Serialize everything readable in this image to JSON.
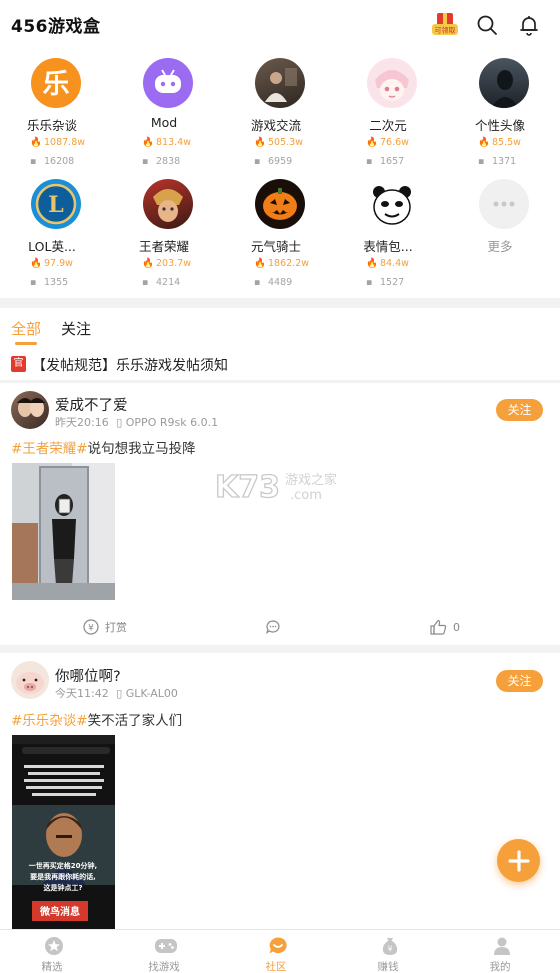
{
  "header": {
    "title": "456游戏盒",
    "gift_badge": "可领取"
  },
  "categories": [
    {
      "name": "乐乐杂谈",
      "heat": "1087.8w",
      "posts": "16208",
      "icon": "le-logo-icon"
    },
    {
      "name": "Mod",
      "heat": "813.4w",
      "posts": "2838",
      "icon": "gamepad-icon"
    },
    {
      "name": "游戏交流",
      "heat": "505.3w",
      "posts": "6959",
      "icon": "photo-icon"
    },
    {
      "name": "二次元",
      "heat": "76.6w",
      "posts": "1657",
      "icon": "anime-icon"
    },
    {
      "name": "个性头像",
      "heat": "85.5w",
      "posts": "1371",
      "icon": "portrait-icon"
    },
    {
      "name": "LOL英...",
      "heat": "97.9w",
      "posts": "1355",
      "icon": "lol-icon"
    },
    {
      "name": "王者荣耀",
      "heat": "203.7w",
      "posts": "4214",
      "icon": "hero-icon"
    },
    {
      "name": "元气骑士",
      "heat": "1862.2w",
      "posts": "4489",
      "icon": "pumpkin-icon"
    },
    {
      "name": "表情包...",
      "heat": "84.4w",
      "posts": "1527",
      "icon": "meme-icon"
    },
    {
      "name": "更多",
      "heat": "",
      "posts": "",
      "icon": "more-icon"
    }
  ],
  "tabs": {
    "all": "全部",
    "follow": "关注"
  },
  "notice": {
    "badge": "官",
    "text": "【发帖规范】乐乐游戏发帖须知"
  },
  "posts": [
    {
      "user": "爱成不了爱",
      "time": "昨天20:16",
      "device": "OPPO R9sk 6.0.1",
      "follow": "关注",
      "tag": "#王者荣耀#",
      "text": "说句想我立马投降",
      "tip_label": "打赏",
      "likes": "0"
    },
    {
      "user": "你哪位啊?",
      "time": "今天11:42",
      "device": "GLK-AL00",
      "follow": "关注",
      "tag": "#乐乐杂谈#",
      "text": "笑不活了家人们",
      "image_text": {
        "caption1": "一世再买定格20分钟,",
        "caption2": "要是我再跟你耗的话,",
        "caption3": "这是钟点工?",
        "banner": "微鸟消息"
      }
    }
  ],
  "watermark": {
    "logo": "K73",
    "sub1": "游戏之家",
    "sub2": ".com"
  },
  "bottom_nav": [
    {
      "label": "精选"
    },
    {
      "label": "找游戏"
    },
    {
      "label": "社区"
    },
    {
      "label": "赚钱"
    },
    {
      "label": "我的"
    }
  ],
  "colors": {
    "accent": "#f5a03a",
    "official_badge": "#e23a2f"
  }
}
